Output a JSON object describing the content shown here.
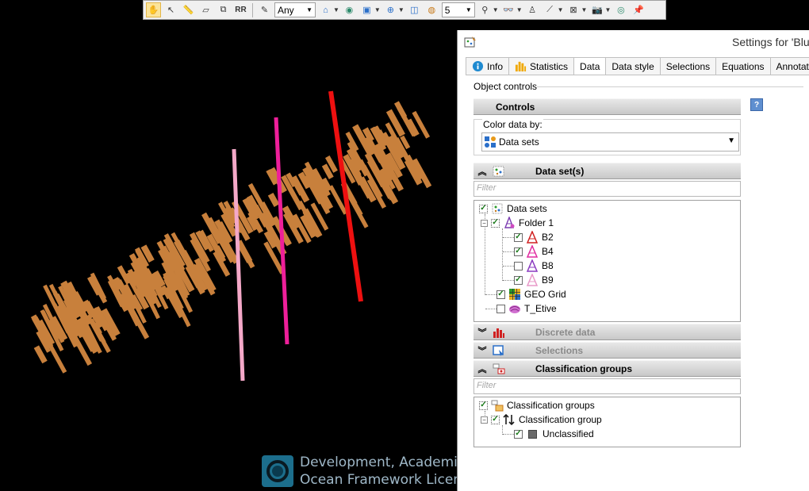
{
  "toolbar": {
    "selection_combo": "Any",
    "count_combo": "5",
    "buttons": [
      "pan-hand",
      "select-arrow",
      "measure",
      "eraser",
      "copy",
      "rr-tool",
      "edit-pencil",
      "home-view",
      "eye-view",
      "box-view",
      "target-view",
      "cube-view",
      "globe-view",
      "zoom-dropdown",
      "binoculars",
      "person-view",
      "axis-tool",
      "plot-tool",
      "close-tool",
      "camera-tool",
      "eye-cross",
      "pin"
    ]
  },
  "watermark": {
    "line1": "Development, Academia",
    "line2": "Ocean Framework Licens"
  },
  "panel": {
    "title": "Settings for 'Blu",
    "tabs": [
      "Info",
      "Statistics",
      "Data",
      "Data style",
      "Selections",
      "Equations",
      "Annotatio"
    ],
    "object_controls_label": "Object controls",
    "help_label": "?",
    "controls_section": "Controls",
    "color_by_label": "Color data by:",
    "color_by_value": "Data sets",
    "datasets_section": "Data set(s)",
    "filter_placeholder": "Filter",
    "datasets_tree": {
      "root": "Data sets",
      "folder": "Folder 1",
      "wells": [
        {
          "name": "B2",
          "checked": true
        },
        {
          "name": "B4",
          "checked": true
        },
        {
          "name": "B8",
          "checked": false
        },
        {
          "name": "B9",
          "checked": true
        }
      ],
      "grid": "GEO Grid",
      "surface": "T_Etive"
    },
    "discrete_section": "Discrete data",
    "selections_section": "Selections",
    "classification_section": "Classification groups",
    "class_filter_placeholder": "Filter",
    "class_tree": {
      "root": "Classification groups",
      "group": "Classification group",
      "item": "Unclassified"
    }
  },
  "colors": {
    "point_cloud": "#c8803c",
    "well_pink": "#f4a8c8",
    "well_magenta": "#ee1f9a",
    "well_red": "#ee1010",
    "panel_bg": "#ffffff",
    "checkbox_green": "#1a7a1a"
  }
}
